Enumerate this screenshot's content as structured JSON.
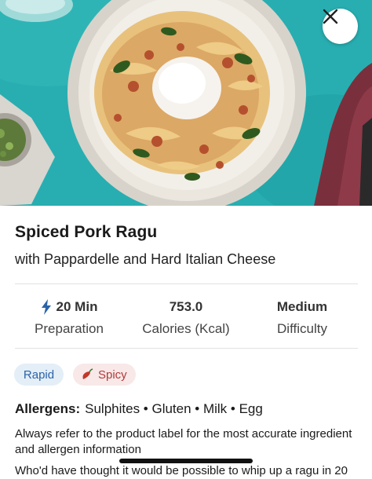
{
  "recipe": {
    "title": "Spiced Pork Ragu",
    "subtitle": "with Pappardelle and Hard Italian Cheese"
  },
  "stats": [
    {
      "value": "20 Min",
      "label": "Preparation",
      "icon": "lightning-icon"
    },
    {
      "value": "753.0",
      "label": "Calories (Kcal)"
    },
    {
      "value": "Medium",
      "label": "Difficulty"
    }
  ],
  "tags": [
    {
      "label": "Rapid"
    },
    {
      "label": "Spicy",
      "icon": "chili-pepper-icon"
    }
  ],
  "allergens": {
    "label": "Allergens:",
    "items": "Sulphites • Gluten • Milk • Egg"
  },
  "notice": "Always refer to the product label for the most accurate ingredient and allergen information",
  "description": "Who'd have thought it would be possible to whip up a ragu in 20",
  "colors": {
    "accent_blue": "#2c63a8",
    "rapid_bg": "#e4eef7",
    "spicy_bg": "#f8e8e8",
    "spicy_text": "#b23a3a",
    "hero_bg": "#2db3b5"
  }
}
